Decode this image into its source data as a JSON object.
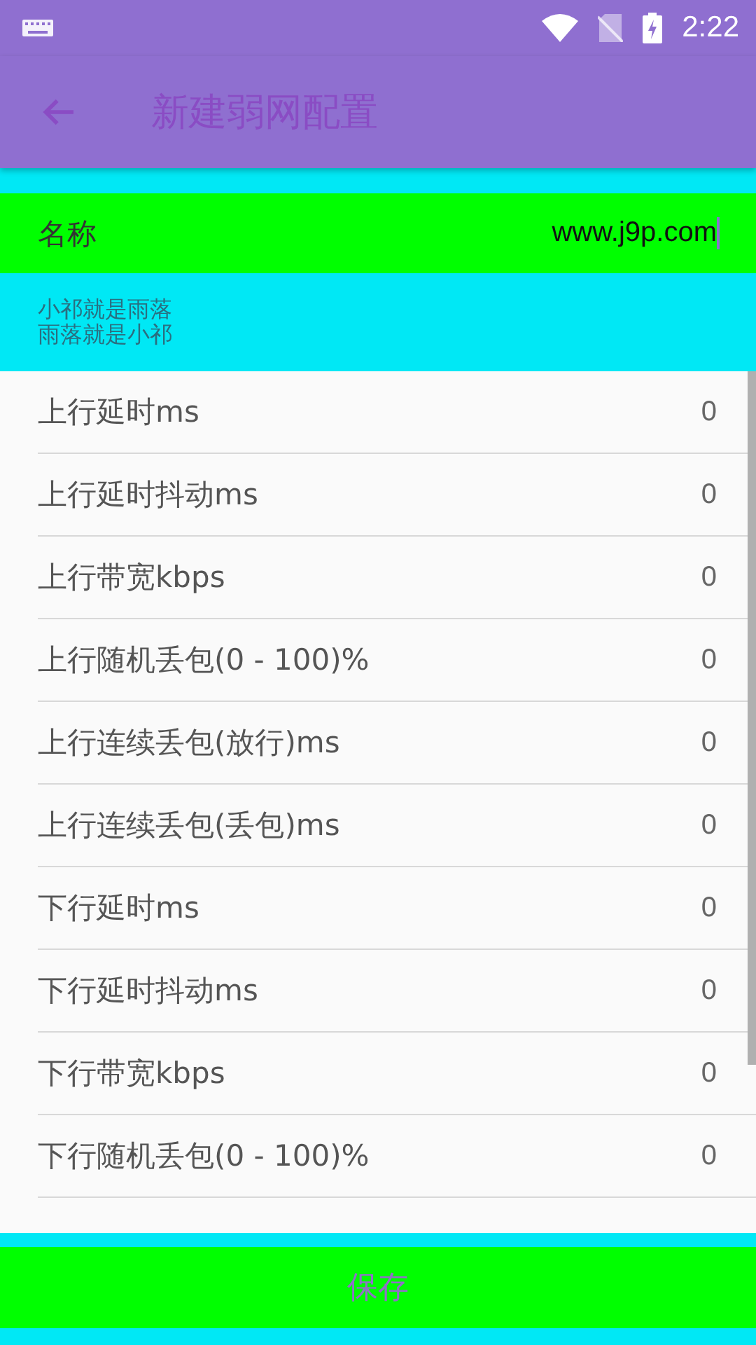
{
  "status_bar": {
    "time": "2:22"
  },
  "app_bar": {
    "title": "新建弱网配置"
  },
  "name_field": {
    "label": "名称",
    "value": "www.j9p.com"
  },
  "hint": {
    "lines": [
      "小祁就是雨落",
      "雨落就是小祁"
    ]
  },
  "settings": [
    {
      "label": "上行延时ms",
      "value": "0"
    },
    {
      "label": "上行延时抖动ms",
      "value": "0"
    },
    {
      "label": "上行带宽kbps",
      "value": "0"
    },
    {
      "label": "上行随机丢包(0 - 100)%",
      "value": "0"
    },
    {
      "label": "上行连续丢包(放行)ms",
      "value": "0"
    },
    {
      "label": "上行连续丢包(丢包)ms",
      "value": "0"
    },
    {
      "label": "下行延时ms",
      "value": "0"
    },
    {
      "label": "下行延时抖动ms",
      "value": "0"
    },
    {
      "label": "下行带宽kbps",
      "value": "0"
    },
    {
      "label": "下行随机丢包(0 - 100)%",
      "value": "0"
    }
  ],
  "save_button": {
    "label": "保存"
  }
}
